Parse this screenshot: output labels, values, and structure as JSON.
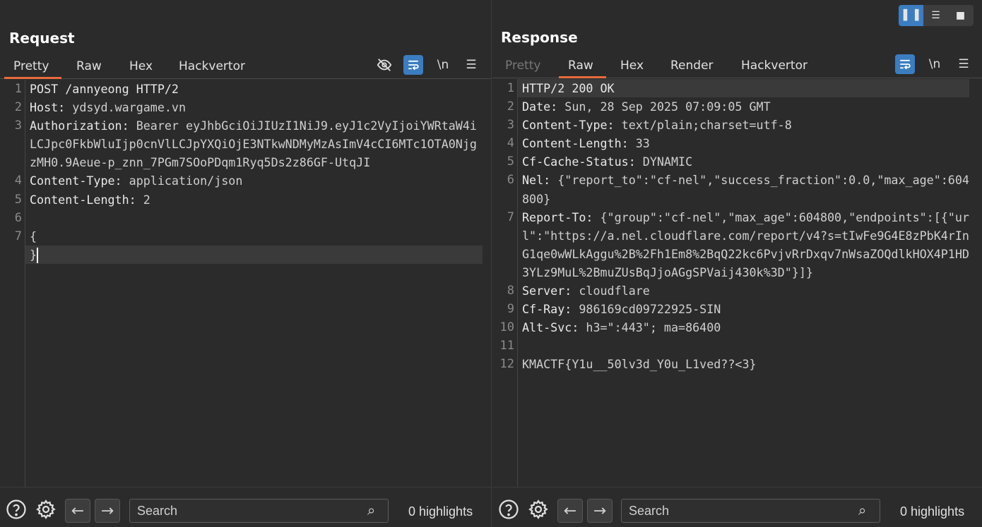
{
  "request": {
    "title": "Request",
    "tabs": [
      {
        "label": "Pretty",
        "active": true
      },
      {
        "label": "Raw"
      },
      {
        "label": "Hex"
      },
      {
        "label": "Hackvertor"
      }
    ],
    "toolbar": {
      "newline_label": "\\n",
      "menu_icon": "menu-icon",
      "hide_icon": "eye-off-icon",
      "wrap_icon": "wrap-icon"
    },
    "lines": [
      {
        "num": "1",
        "text": "POST /annyeong HTTP/2"
      },
      {
        "num": "2",
        "key": "Host:",
        "value": " ydsyd.wargame.vn"
      },
      {
        "num": "3",
        "key": "Authorization:",
        "value": " Bearer eyJhbGciOiJIUzI1NiJ9.eyJ1c2VyIjoiYWRtaW4iLCJpc0FkbWluIjp0cnVlLCJpYXQiOjE3NTkwNDMyMzAsImV4cCI6MTc1OTA0NjgzMH0.9Aeue-p_znn_7PGm7SOoPDqm1Ryq5Ds2z86GF-UtqJI"
      },
      {
        "num": "4",
        "key": "Content-Type:",
        "value": " application/json"
      },
      {
        "num": "5",
        "key": "Content-Length:",
        "value": " 2"
      },
      {
        "num": "6",
        "text": ""
      },
      {
        "num": "7",
        "text": "{"
      },
      {
        "num": "",
        "text": "}"
      }
    ],
    "footer": {
      "search_placeholder": "Search",
      "highlights": "0 highlights"
    }
  },
  "response": {
    "title": "Response",
    "tabs": [
      {
        "label": "Pretty",
        "disabled": true
      },
      {
        "label": "Raw",
        "active": true
      },
      {
        "label": "Hex"
      },
      {
        "label": "Render"
      },
      {
        "label": "Hackvertor"
      }
    ],
    "toolbar": {
      "newline_label": "\\n"
    },
    "lines": [
      {
        "num": "1",
        "text": "HTTP/2 200 OK"
      },
      {
        "num": "2",
        "key": "Date:",
        "value": " Sun, 28 Sep 2025 07:09:05 GMT"
      },
      {
        "num": "3",
        "key": "Content-Type:",
        "value": " text/plain;charset=utf-8"
      },
      {
        "num": "4",
        "key": "Content-Length:",
        "value": " 33"
      },
      {
        "num": "5",
        "key": "Cf-Cache-Status:",
        "value": " DYNAMIC"
      },
      {
        "num": "6",
        "key": "Nel:",
        "value": " {\"report_to\":\"cf-nel\",\"success_fraction\":0.0,\"max_age\":604800}"
      },
      {
        "num": "7",
        "key": "Report-To:",
        "value": " {\"group\":\"cf-nel\",\"max_age\":604800,\"endpoints\":[{\"url\":\"https://a.nel.cloudflare.com/report/v4?s=tIwFe9G4E8zPbK4rInG1qe0wWLkAggu%2B%2Fh1Em8%2BqQ22kc6PvjvRrDxqv7nWsaZOQdlkHOX4P1HD3YLz9MuL%2BmuZUsBqJjoAGgSPVaij430k%3D\"}]}"
      },
      {
        "num": "8",
        "key": "Server:",
        "value": " cloudflare"
      },
      {
        "num": "9",
        "key": "Cf-Ray:",
        "value": " 986169cd09722925-SIN"
      },
      {
        "num": "10",
        "key": "Alt-Svc:",
        "value": " h3=\":443\"; ma=86400"
      },
      {
        "num": "11",
        "text": ""
      },
      {
        "num": "12",
        "text": "KMACTF{Y1u__50lv3d_Y0u_L1ved??<3}"
      }
    ],
    "footer": {
      "search_placeholder": "Search",
      "highlights": "0 highlights"
    }
  }
}
